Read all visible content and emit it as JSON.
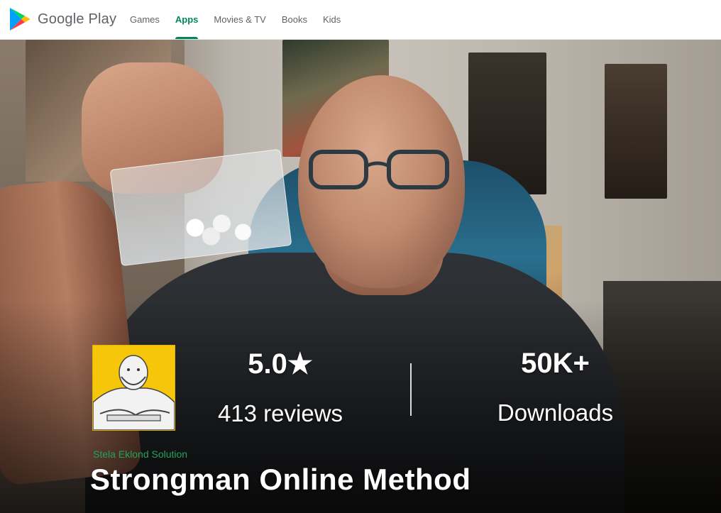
{
  "header": {
    "brand": "Google Play",
    "nav": [
      "Games",
      "Apps",
      "Movies & TV",
      "Books",
      "Kids"
    ],
    "active_nav": "Apps"
  },
  "app": {
    "developer": "Stela Eklond Solution",
    "title": "Strongman Online Method",
    "rating": "5.0★",
    "reviews": "413 reviews",
    "downloads_value": "50K+",
    "downloads_label": "Downloads",
    "icon": "strongman-cartoon-icon"
  },
  "colors": {
    "accent": "#01875f",
    "developer": "#22a35a",
    "icon_bg": "#f6c60a"
  }
}
